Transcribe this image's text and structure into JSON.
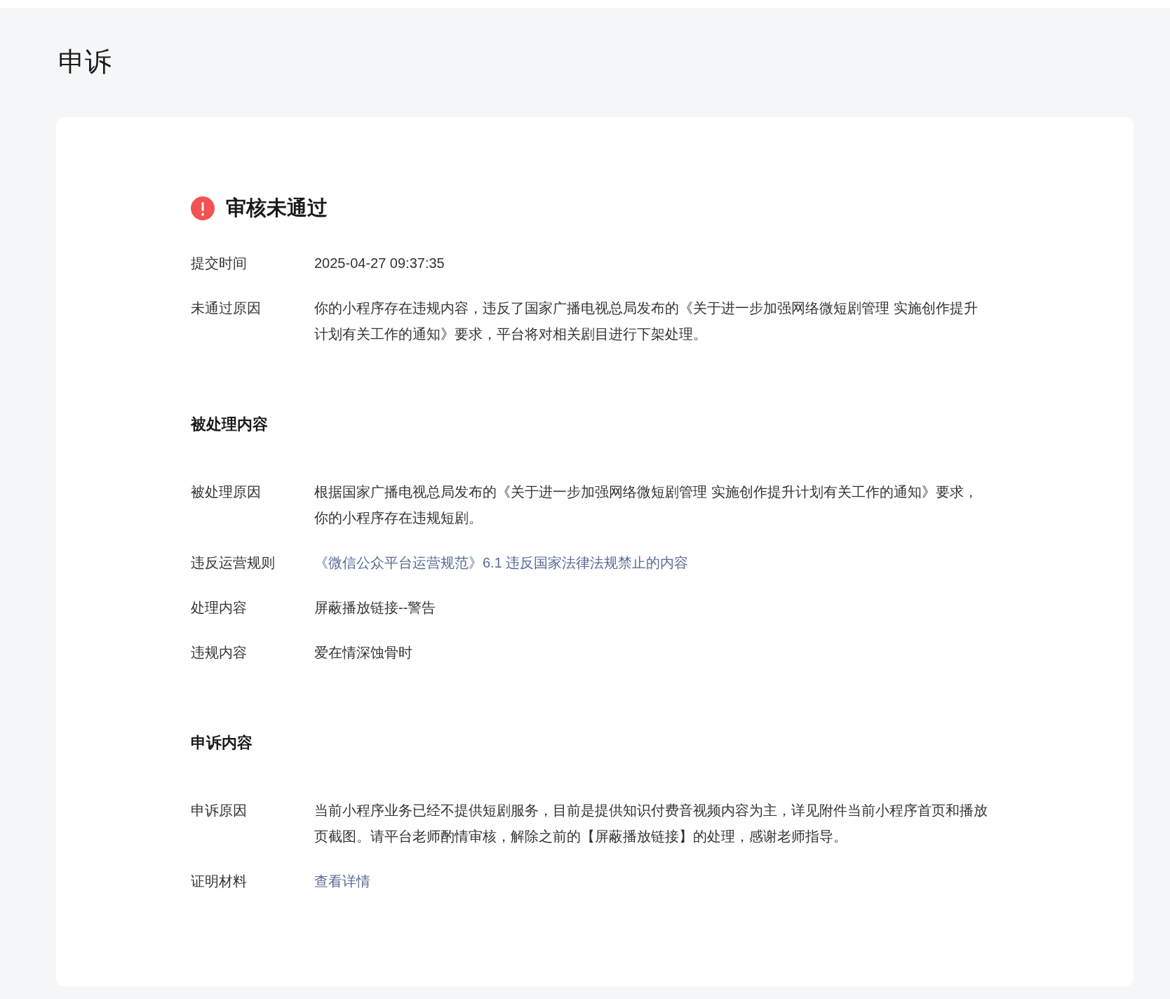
{
  "page_title": "申诉",
  "status": {
    "kind": "rejected",
    "title": "审核未通过"
  },
  "rows": [
    {
      "label": "提交时间",
      "value": "2025-04-27 09:37:35",
      "kind": "text"
    },
    {
      "label": "未通过原因",
      "value": "你的小程序存在违规内容，违反了国家广播电视总局发布的《关于进一步加强网络微短剧管理 实施创作提升计划有关工作的通知》要求，平台将对相关剧目进行下架处理。",
      "kind": "text"
    }
  ],
  "sections": [
    {
      "title": "被处理内容",
      "rows": [
        {
          "label": "被处理原因",
          "value": "根据国家广播电视总局发布的《关于进一步加强网络微短剧管理 实施创作提升计划有关工作的通知》要求，你的小程序存在违规短剧。",
          "kind": "text"
        },
        {
          "label": "违反运营规则",
          "value": "《微信公众平台运营规范》6.1 违反国家法律法规禁止的内容",
          "kind": "link"
        },
        {
          "label": "处理内容",
          "value": "屏蔽播放链接--警告",
          "kind": "text"
        },
        {
          "label": "违规内容",
          "value": "爱在情深蚀骨时",
          "kind": "text"
        }
      ]
    },
    {
      "title": "申诉内容",
      "rows": [
        {
          "label": "申诉原因",
          "value": "当前小程序业务已经不提供短剧服务，目前是提供知识付费音视频内容为主，详见附件当前小程序首页和播放页截图。请平台老师酌情审核，解除之前的【屏蔽播放链接】的处理，感谢老师指导。",
          "kind": "text"
        },
        {
          "label": "证明材料",
          "value": "查看详情",
          "kind": "link"
        }
      ]
    }
  ]
}
